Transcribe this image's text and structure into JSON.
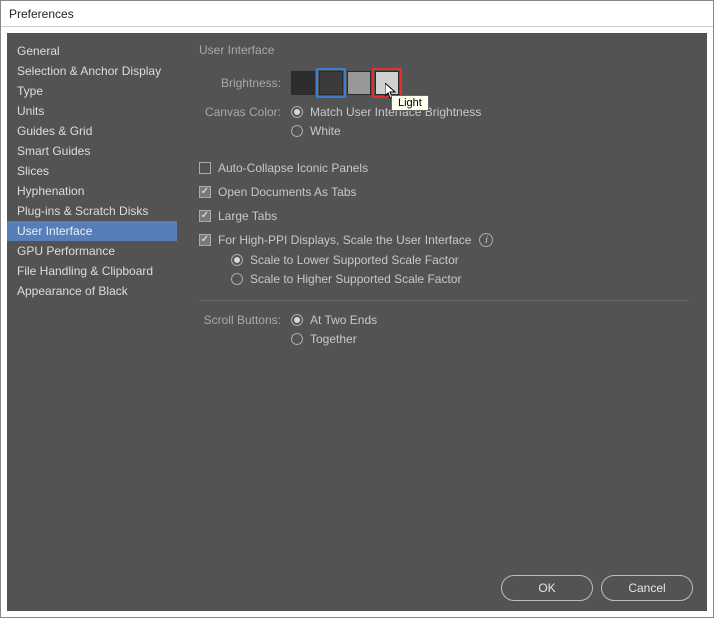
{
  "window": {
    "title": "Preferences"
  },
  "sidebar": {
    "items": [
      {
        "label": "General"
      },
      {
        "label": "Selection & Anchor Display"
      },
      {
        "label": "Type"
      },
      {
        "label": "Units"
      },
      {
        "label": "Guides & Grid"
      },
      {
        "label": "Smart Guides"
      },
      {
        "label": "Slices"
      },
      {
        "label": "Hyphenation"
      },
      {
        "label": "Plug-ins & Scratch Disks"
      },
      {
        "label": "User Interface"
      },
      {
        "label": "GPU Performance"
      },
      {
        "label": "File Handling & Clipboard"
      },
      {
        "label": "Appearance of Black"
      }
    ],
    "selected_index": 9
  },
  "main": {
    "section_title": "User Interface",
    "brightness": {
      "label": "Brightness:",
      "swatches": [
        {
          "name": "dark",
          "color": "#2d2d2d",
          "selected": false
        },
        {
          "name": "medium-dark",
          "color": "#3b3b3b",
          "selected": true
        },
        {
          "name": "medium-light",
          "color": "#989898",
          "selected": false
        },
        {
          "name": "light",
          "color": "#d0d0d0",
          "selected": false,
          "highlighted": true
        }
      ],
      "tooltip": "Light"
    },
    "canvas_color": {
      "label": "Canvas Color:",
      "options": [
        {
          "label": "Match User Interface Brightness",
          "checked": true
        },
        {
          "label": "White",
          "checked": false
        }
      ]
    },
    "checkboxes": {
      "auto_collapse": {
        "label": "Auto-Collapse Iconic Panels",
        "checked": false
      },
      "open_as_tabs": {
        "label": "Open Documents As Tabs",
        "checked": true
      },
      "large_tabs": {
        "label": "Large Tabs",
        "checked": true
      },
      "high_ppi": {
        "label": "For High-PPI Displays, Scale the User Interface",
        "checked": true
      }
    },
    "high_ppi_options": [
      {
        "label": "Scale to Lower Supported Scale Factor",
        "checked": true
      },
      {
        "label": "Scale to Higher Supported Scale Factor",
        "checked": false
      }
    ],
    "scroll_buttons": {
      "label": "Scroll Buttons:",
      "options": [
        {
          "label": "At Two Ends",
          "checked": true
        },
        {
          "label": "Together",
          "checked": false
        }
      ]
    }
  },
  "buttons": {
    "ok": "OK",
    "cancel": "Cancel"
  }
}
